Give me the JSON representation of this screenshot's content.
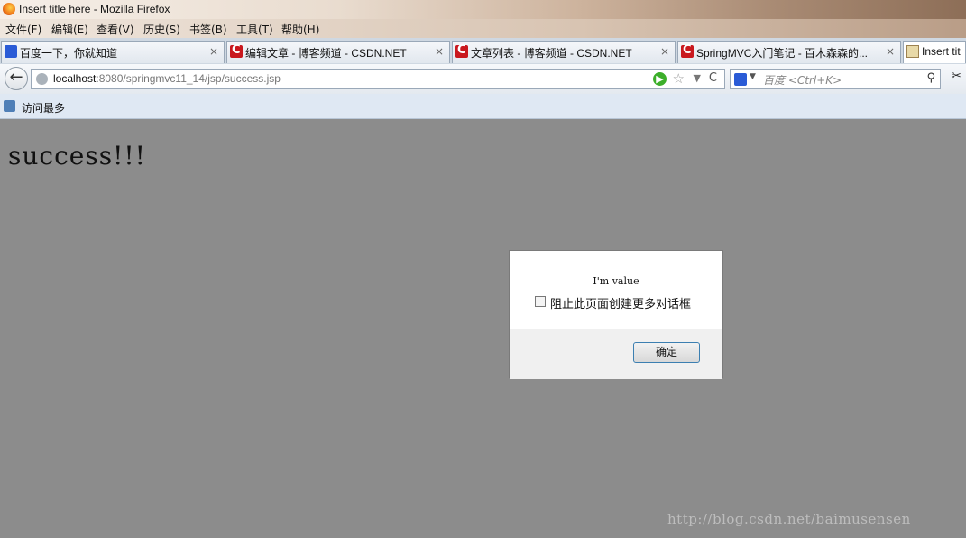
{
  "window": {
    "title": "Insert title here - Mozilla Firefox"
  },
  "menu": [
    "文件(F)",
    "编辑(E)",
    "查看(V)",
    "历史(S)",
    "书签(B)",
    "工具(T)",
    "帮助(H)"
  ],
  "tabs": [
    {
      "label": "百度一下，你就知道",
      "icon": "baidu-paw-icon",
      "close": "×"
    },
    {
      "label": "编辑文章 - 博客频道 - CSDN.NET",
      "icon": "csdn-icon",
      "close": "×"
    },
    {
      "label": "文章列表 - 博客频道 - CSDN.NET",
      "icon": "csdn-icon",
      "close": "×"
    },
    {
      "label": "SpringMVC入门笔记 - 百木森森的...",
      "icon": "csdn-icon",
      "close": "×"
    },
    {
      "label": "Insert tit",
      "icon": "page-icon",
      "close": ""
    }
  ],
  "nav": {
    "back": "←",
    "url_host": "localhost",
    "url_rest": ":8080/springmvc11_14/jsp/success.jsp",
    "go": "▶",
    "star": "☆",
    "dropdown": "▼",
    "reload": "C",
    "search_placeholder": "百度 <Ctrl+K>",
    "engine_dropdown": "▼",
    "search_icon": "⚲",
    "extra_icon": "✂"
  },
  "bookmarks": {
    "item": "访问最多"
  },
  "page": {
    "heading": "success!!!"
  },
  "dialog": {
    "message": "I'm value",
    "checkbox_label": "阻止此页面创建更多对话框",
    "ok_label": "确定"
  },
  "watermark": "http://blog.csdn.net/baimusensen"
}
